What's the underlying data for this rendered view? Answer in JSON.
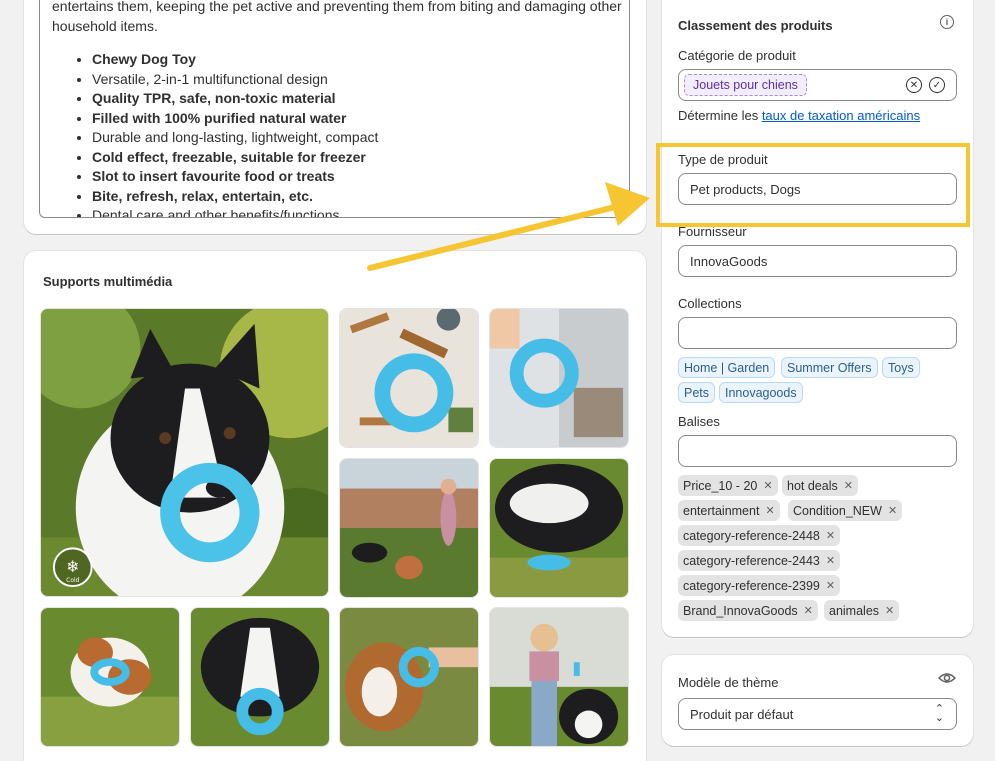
{
  "description": {
    "intro": "entertains them, keeping the pet active and preventing them from biting and damaging other household items.",
    "bullets": [
      {
        "text": "Chewy Dog Toy",
        "bold": true
      },
      {
        "text": "Versatile, 2-in-1 multifunctional design",
        "bold": false
      },
      {
        "text": "Quality TPR, safe, non-toxic material",
        "bold": true
      },
      {
        "text": "Filled with 100% purified natural water",
        "bold": true
      },
      {
        "text": "Durable and long-lasting, lightweight, compact",
        "bold": false
      },
      {
        "text": "Cold effect, freezable, suitable for freezer",
        "bold": true
      },
      {
        "text": "Slot to insert favourite food or treats",
        "bold": true
      },
      {
        "text": "Bite, refresh, relax, entertain, etc.",
        "bold": true
      },
      {
        "text": "Dental care and other benefits/functions",
        "bold": false
      }
    ]
  },
  "media": {
    "title": "Supports multimédia",
    "badge_text": "Cold"
  },
  "classification": {
    "title": "Classement des produits",
    "category_label": "Catégorie de produit",
    "category_value": "Jouets pour chiens",
    "tax_note_prefix": "Détermine les ",
    "tax_link": "taux de taxation américains",
    "type_label": "Type de produit",
    "type_value": "Pet products, Dogs",
    "vendor_label": "Fournisseur",
    "vendor_value": "InnovaGoods",
    "collections_label": "Collections",
    "collections": [
      "Home | Garden",
      "Summer Offers",
      "Toys",
      "Pets",
      "Innovagoods"
    ],
    "tags_label": "Balises",
    "tags": [
      "Price_10 - 20",
      "hot deals",
      "entertainment",
      "Condition_NEW",
      "category-reference-2448",
      "category-reference-2443",
      "category-reference-2399",
      "Brand_InnovaGoods",
      "animales"
    ]
  },
  "theme": {
    "label": "Modèle de thème",
    "value": "Produit par défaut"
  },
  "colors": {
    "highlight": "#f6c532",
    "category_chip": "#f3eeff",
    "collection_chip": "#eaf4ff",
    "tag_chip": "#e3e3e3",
    "link": "#005bd3"
  }
}
